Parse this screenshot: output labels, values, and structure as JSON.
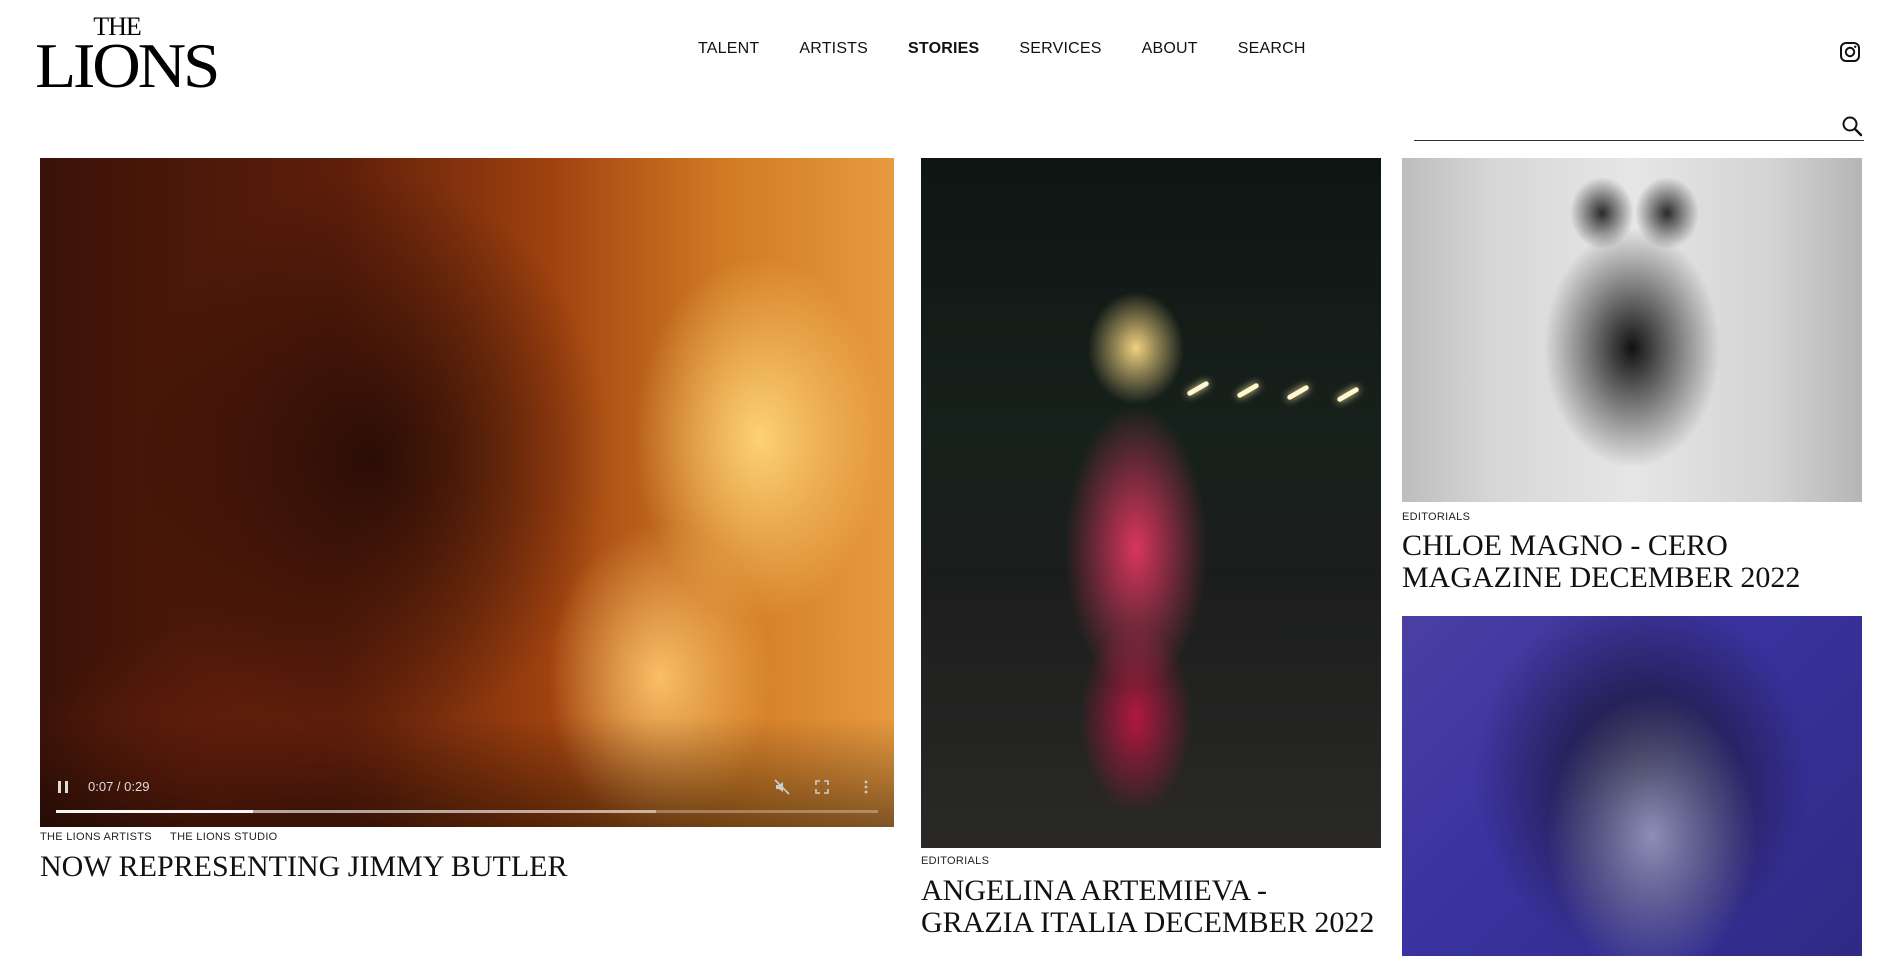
{
  "logo": {
    "line1": "THE",
    "line2": "LIONS"
  },
  "nav": {
    "items": [
      {
        "label": "TALENT"
      },
      {
        "label": "ARTISTS"
      },
      {
        "label": "STORIES"
      },
      {
        "label": "SERVICES"
      },
      {
        "label": "ABOUT"
      },
      {
        "label": "SEARCH"
      }
    ],
    "active": "STORIES"
  },
  "header": {
    "social_icon": "instagram-icon"
  },
  "search": {
    "value": "",
    "placeholder": "",
    "icon": "search-icon"
  },
  "stories": [
    {
      "media_type": "video",
      "tags": [
        "THE LIONS ARTISTS",
        "THE LIONS STUDIO"
      ],
      "title": "NOW REPRESENTING JIMMY BUTLER",
      "video": {
        "time": "0:07 / 0:29",
        "progress": 0.24,
        "buffered": 0.73,
        "muted": true
      }
    },
    {
      "media_type": "image",
      "tags": [
        "EDITORIALS"
      ],
      "title": "ANGELINA ARTEMIEVA - GRAZIA ITALIA DECEMBER 2022"
    },
    {
      "media_type": "image",
      "tags": [
        "EDITORIALS"
      ],
      "title": "CHLOE MAGNO - CERO MAGAZINE DECEMBER 2022"
    },
    {
      "media_type": "image",
      "tags": [],
      "title": ""
    }
  ]
}
